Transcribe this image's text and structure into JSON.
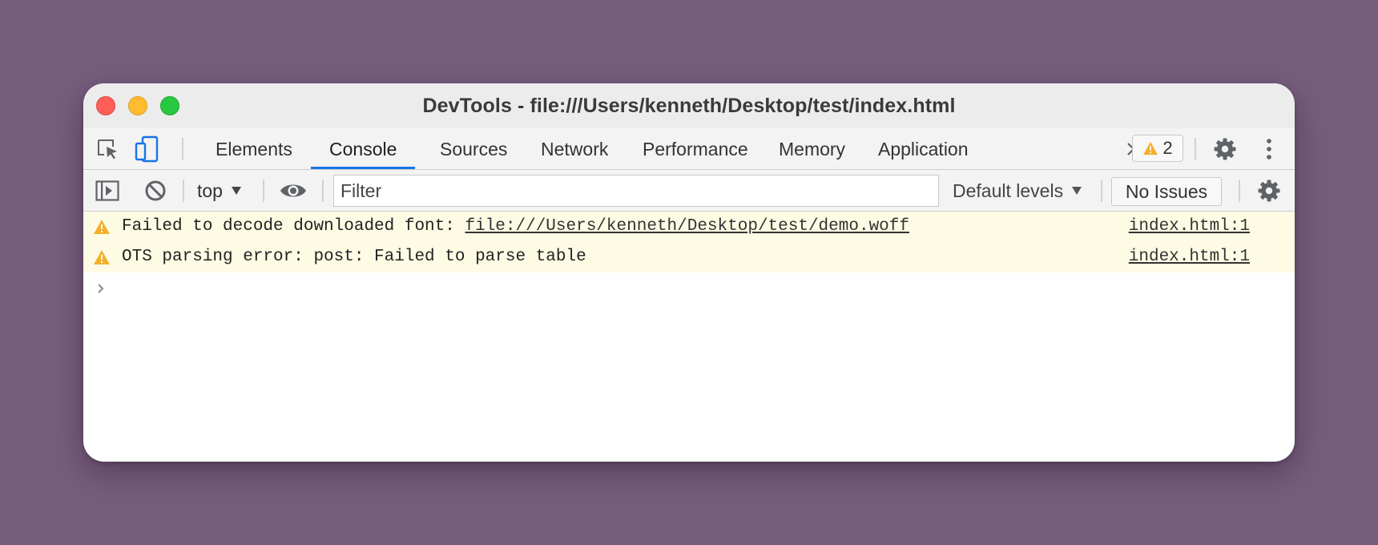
{
  "window": {
    "title": "DevTools - file:///Users/kenneth/Desktop/test/index.html"
  },
  "toolbar_icons": {
    "inspect": "inspect-element-icon",
    "device": "device-toolbar-icon"
  },
  "tabs": [
    {
      "label": "Elements",
      "active": false
    },
    {
      "label": "Console",
      "active": true
    },
    {
      "label": "Sources",
      "active": false
    },
    {
      "label": "Network",
      "active": false
    },
    {
      "label": "Performance",
      "active": false
    },
    {
      "label": "Memory",
      "active": false
    },
    {
      "label": "Application",
      "active": false
    }
  ],
  "issues_badge": {
    "count": "2"
  },
  "console_toolbar": {
    "context": "top",
    "filter_placeholder": "Filter",
    "filter_value": "",
    "levels": "Default levels",
    "issues": "No Issues"
  },
  "messages": [
    {
      "level": "warning",
      "text": "Failed to decode downloaded font: ",
      "link": "file:///Users/kenneth/Desktop/test/demo.woff",
      "source": "index.html:1"
    },
    {
      "level": "warning",
      "text": "OTS parsing error: post: Failed to parse table",
      "link": "",
      "source": "index.html:1"
    }
  ],
  "colors": {
    "background": "#765d7d",
    "accent": "#1a73e8",
    "warning_bg": "#fefbe4",
    "warning_icon": "#f2b12b"
  }
}
